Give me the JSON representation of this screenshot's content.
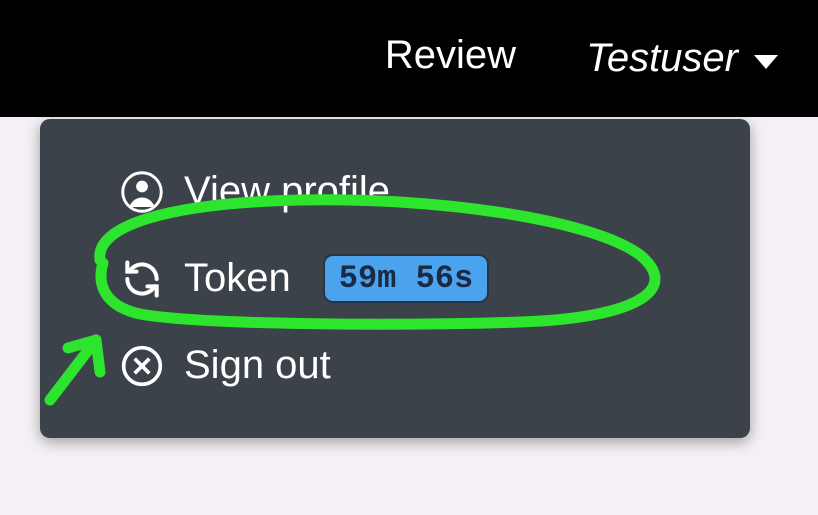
{
  "topbar": {
    "review_label": "Review",
    "username": "Testuser"
  },
  "menu": {
    "view_profile_label": "View profile",
    "token_label": "Token",
    "token_countdown": "59m 56s",
    "sign_out_label": "Sign out"
  },
  "annotation": {
    "color": "#2ee52e"
  }
}
